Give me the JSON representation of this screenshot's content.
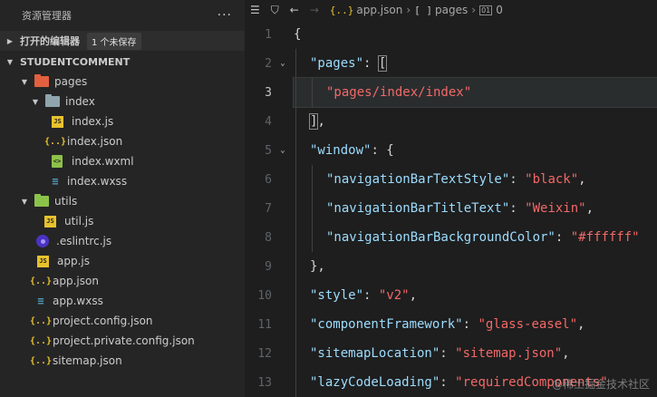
{
  "sidebar": {
    "title": "资源管理器",
    "more": "···",
    "open_editors": {
      "label": "打开的编辑器",
      "badge": "1 个未保存"
    },
    "project": {
      "label": "STUDENTCOMMENT"
    },
    "tree": [
      {
        "label": "pages",
        "type": "folder-pages"
      },
      {
        "label": "index",
        "type": "folder-index"
      },
      {
        "label": "index.js",
        "type": "js",
        "icon_text": "JS"
      },
      {
        "label": "index.json",
        "type": "json",
        "icon_text": "{..}"
      },
      {
        "label": "index.wxml",
        "type": "wxml",
        "icon_text": "<>"
      },
      {
        "label": "index.wxss",
        "type": "wxss",
        "icon_text": "≡"
      },
      {
        "label": "utils",
        "type": "folder-utils"
      },
      {
        "label": "util.js",
        "type": "js",
        "icon_text": "JS"
      },
      {
        "label": ".eslintrc.js",
        "type": "eslint"
      },
      {
        "label": "app.js",
        "type": "js",
        "icon_text": "JS"
      },
      {
        "label": "app.json",
        "type": "json",
        "icon_text": "{..}"
      },
      {
        "label": "app.wxss",
        "type": "wxss",
        "icon_text": "≡"
      },
      {
        "label": "project.config.json",
        "type": "json",
        "icon_text": "{..}"
      },
      {
        "label": "project.private.config.json",
        "type": "json",
        "icon_text": "{..}"
      },
      {
        "label": "sitemap.json",
        "type": "json",
        "icon_text": "{..}"
      }
    ]
  },
  "editor": {
    "breadcrumbs": {
      "file_icon": "{..}",
      "file": "app.json",
      "array_icon": "[ ]",
      "key": "pages",
      "index_icon": "01",
      "index": "0"
    },
    "lines": [
      {
        "n": "1",
        "parts": [
          [
            "p",
            "{"
          ]
        ]
      },
      {
        "n": "2",
        "parts": [
          [
            "k",
            "\"pages\""
          ],
          [
            "p",
            ": "
          ],
          [
            "brk",
            "["
          ]
        ]
      },
      {
        "n": "3",
        "parts": [
          [
            "s",
            "\"pages/index/index\""
          ]
        ]
      },
      {
        "n": "4",
        "parts": [
          [
            "brk",
            "]"
          ],
          [
            "p",
            ","
          ]
        ]
      },
      {
        "n": "5",
        "parts": [
          [
            "k",
            "\"window\""
          ],
          [
            "p",
            ": {"
          ]
        ]
      },
      {
        "n": "6",
        "parts": [
          [
            "k",
            "\"navigationBarTextStyle\""
          ],
          [
            "p",
            ": "
          ],
          [
            "s",
            "\"black\""
          ],
          [
            "p",
            ","
          ]
        ]
      },
      {
        "n": "7",
        "parts": [
          [
            "k",
            "\"navigationBarTitleText\""
          ],
          [
            "p",
            ": "
          ],
          [
            "s",
            "\"Weixin\""
          ],
          [
            "p",
            ","
          ]
        ]
      },
      {
        "n": "8",
        "parts": [
          [
            "k",
            "\"navigationBarBackgroundColor\""
          ],
          [
            "p",
            ": "
          ],
          [
            "s",
            "\"#ffffff\""
          ]
        ]
      },
      {
        "n": "9",
        "parts": [
          [
            "p",
            "},"
          ]
        ]
      },
      {
        "n": "10",
        "parts": [
          [
            "k",
            "\"style\""
          ],
          [
            "p",
            ": "
          ],
          [
            "s",
            "\"v2\""
          ],
          [
            "p",
            ","
          ]
        ]
      },
      {
        "n": "11",
        "parts": [
          [
            "k",
            "\"componentFramework\""
          ],
          [
            "p",
            ": "
          ],
          [
            "s",
            "\"glass-easel\""
          ],
          [
            "p",
            ","
          ]
        ]
      },
      {
        "n": "12",
        "parts": [
          [
            "k",
            "\"sitemapLocation\""
          ],
          [
            "p",
            ": "
          ],
          [
            "s",
            "\"sitemap.json\""
          ],
          [
            "p",
            ","
          ]
        ]
      },
      {
        "n": "13",
        "parts": [
          [
            "k",
            "\"lazyCodeLoading\""
          ],
          [
            "p",
            ": "
          ],
          [
            "s",
            "\"requiredComponents\""
          ]
        ]
      }
    ],
    "watermark": "@稀土掘金技术社区"
  },
  "colors": {
    "key": "#9cdcfe",
    "string": "#f36868",
    "sidebar_bg": "#252526",
    "editor_bg": "#1e1e1e"
  }
}
